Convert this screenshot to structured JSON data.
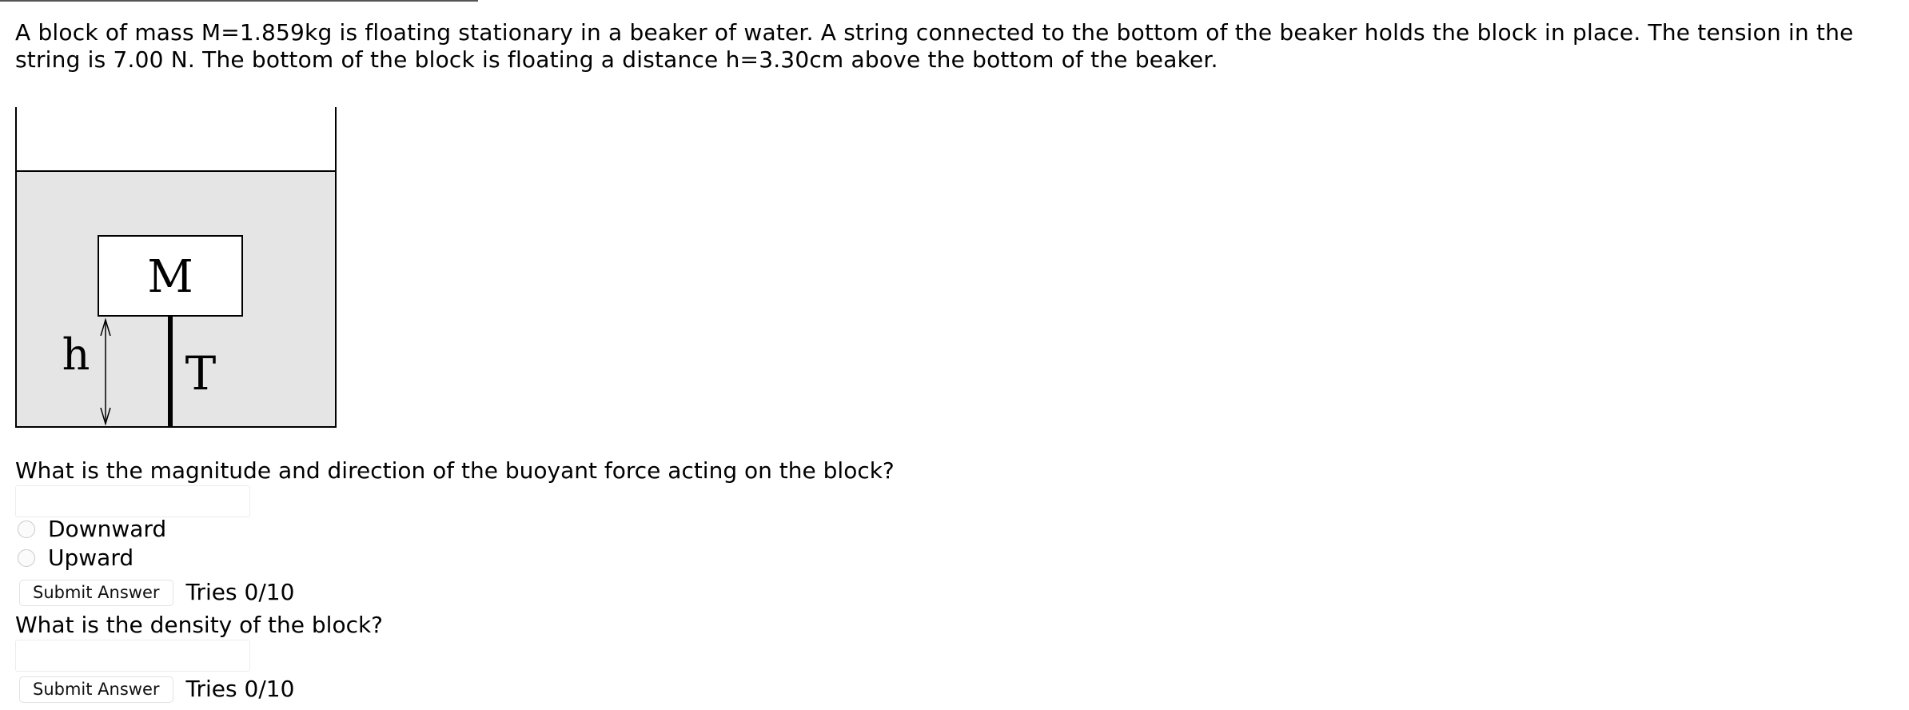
{
  "problem": {
    "text": "A block of mass M=1.859kg is floating stationary in a beaker of water. A string connected to the bottom of the beaker holds the block in place. The tension in the string is 7.00 N. The bottom of the block is floating a distance h=3.30cm above the bottom of the beaker."
  },
  "figure": {
    "block_label": "M",
    "height_label": "h",
    "tension_label": "T",
    "water_color": "#e5e5e5"
  },
  "question1": {
    "prompt": "What is the magnitude and direction of the buoyant force acting on the block?",
    "answer_value": "",
    "options": [
      "Downward",
      "Upward"
    ],
    "submit_label": "Submit Answer",
    "tries": "Tries 0/10"
  },
  "question2": {
    "prompt": "What is the density of the block?",
    "answer_value": "",
    "submit_label": "Submit Answer",
    "tries": "Tries 0/10"
  }
}
